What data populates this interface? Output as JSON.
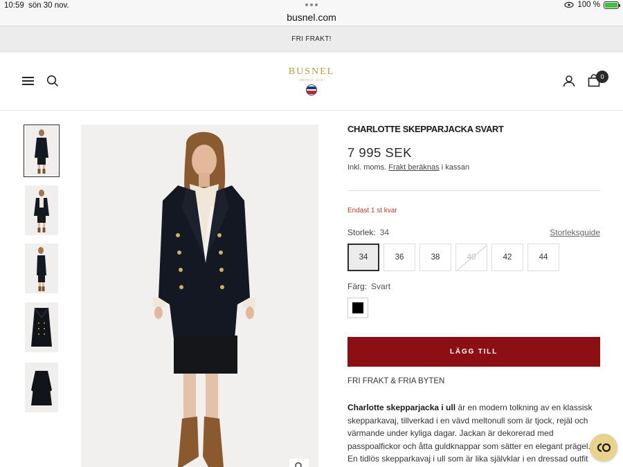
{
  "status_bar": {
    "time": "10:59",
    "date": "sön 30 nov.",
    "url": "busnel.com",
    "battery": "100 %"
  },
  "announcement": {
    "text": "FRI FRAKT!"
  },
  "header": {
    "logo_text": "BUSNEL",
    "logo_subtext": "DEPUIS 1920",
    "cart_count": "0"
  },
  "gallery": {
    "thumbnails": [
      {
        "alt": "front",
        "active": true
      },
      {
        "alt": "front-open",
        "active": false
      },
      {
        "alt": "side",
        "active": false
      },
      {
        "alt": "flat-front",
        "active": false
      },
      {
        "alt": "flat-back",
        "active": false
      }
    ]
  },
  "product": {
    "title": "CHARLOTTE SKEPPARJACKA SVART",
    "price": "7 995 SEK",
    "tax_prefix": "Inkl. moms. ",
    "tax_link": "Frakt beräknas",
    "tax_suffix": " i kassan",
    "stock": "Endast 1 st kvar",
    "size_label": "Storlek:",
    "size_value": "34",
    "size_guide": "Storleksguide",
    "sizes": [
      {
        "label": "34",
        "state": "selected"
      },
      {
        "label": "36",
        "state": "available"
      },
      {
        "label": "38",
        "state": "available"
      },
      {
        "label": "40",
        "state": "disabled"
      },
      {
        "label": "42",
        "state": "available"
      },
      {
        "label": "44",
        "state": "available"
      }
    ],
    "color_label": "Färg:",
    "color_value": "Svart",
    "swatch_color": "#000000",
    "add_to_cart": "LÄGG TILL",
    "shipping_note": "FRI FRAKT & FRIA BYTEN",
    "description_bold": "Charlotte skepparjacka i ull",
    "description_text": " är en modern tolkning av en klassisk skepparkavaj, tillverkad i en vävd meltonull som är tjock, rejäl och värmande under kyliga dagar. Jackan är dekorerad med passpoalfickor och åtta guldknappar som sätter en elegant prägel. En tidlös skepparkavaj i ull som är lika självklar i en dressad outfit"
  },
  "colors": {
    "accent": "#8b0f13",
    "stock": "#c0392b",
    "logo_gold": "#b99a3a",
    "chat_bg": "#e8d28d"
  }
}
